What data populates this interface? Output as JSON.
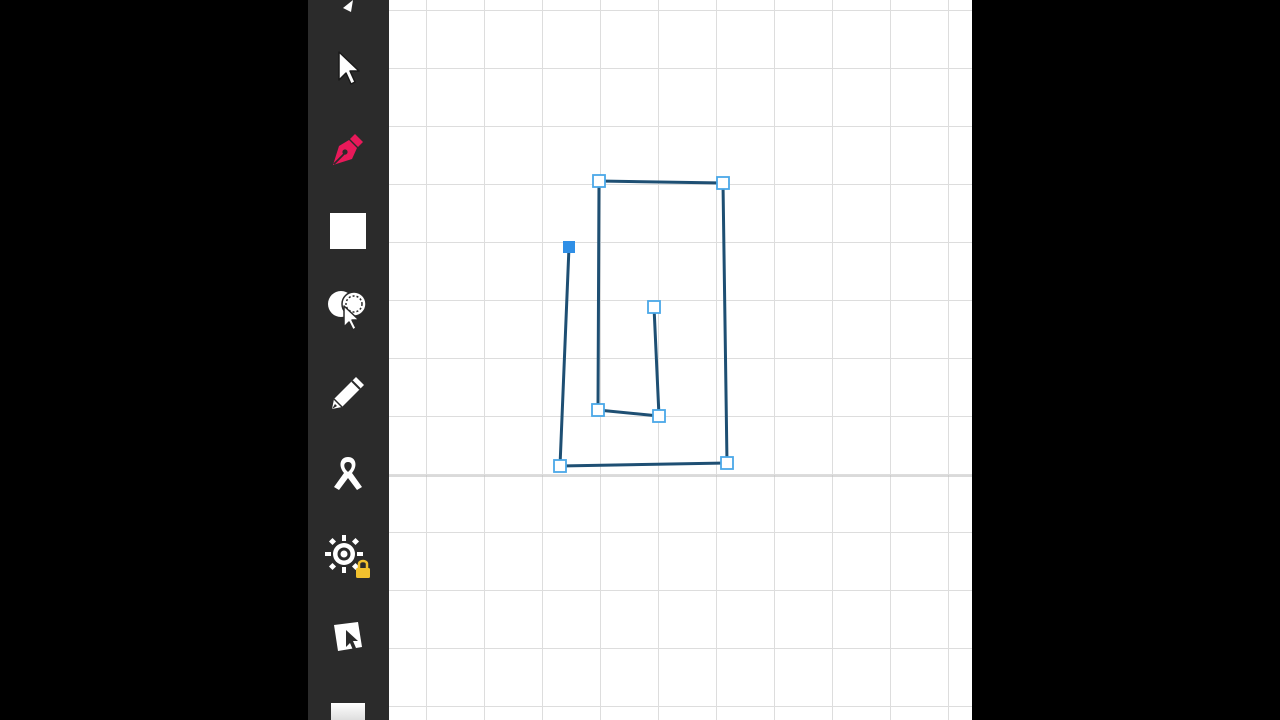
{
  "app": {
    "toolbar": {
      "tools": [
        {
          "name": "select-tool",
          "icon": "cursor-arrow-icon",
          "active": false
        },
        {
          "name": "pen-tool",
          "icon": "pen-nib-icon",
          "active": true,
          "color": "#e8195a"
        },
        {
          "name": "shape-fill-tool",
          "icon": "white-square-icon",
          "active": false
        },
        {
          "name": "style-picker-tool",
          "icon": "color-picker-icon",
          "active": false
        },
        {
          "name": "pencil-tool",
          "icon": "pencil-icon",
          "active": false
        },
        {
          "name": "ribbon-tool",
          "icon": "ribbon-icon",
          "active": false
        },
        {
          "name": "settings-tool",
          "icon": "gear-lock-icon",
          "active": false,
          "locked": true,
          "lock_color": "#f2c12e"
        },
        {
          "name": "image-tool",
          "icon": "image-cursor-icon",
          "active": false
        },
        {
          "name": "color-swatch-tool",
          "icon": "gray-swatch-icon",
          "active": false
        }
      ]
    },
    "canvas": {
      "background": "#ffffff",
      "grid_color": "#dddddd",
      "path": {
        "stroke_color": "#1e4f73",
        "anchor_fill": "#ffffff",
        "anchor_stroke": "#4aa8e8",
        "selected_anchor_color": "#2f8fe6",
        "anchor_count": 9
      }
    }
  }
}
